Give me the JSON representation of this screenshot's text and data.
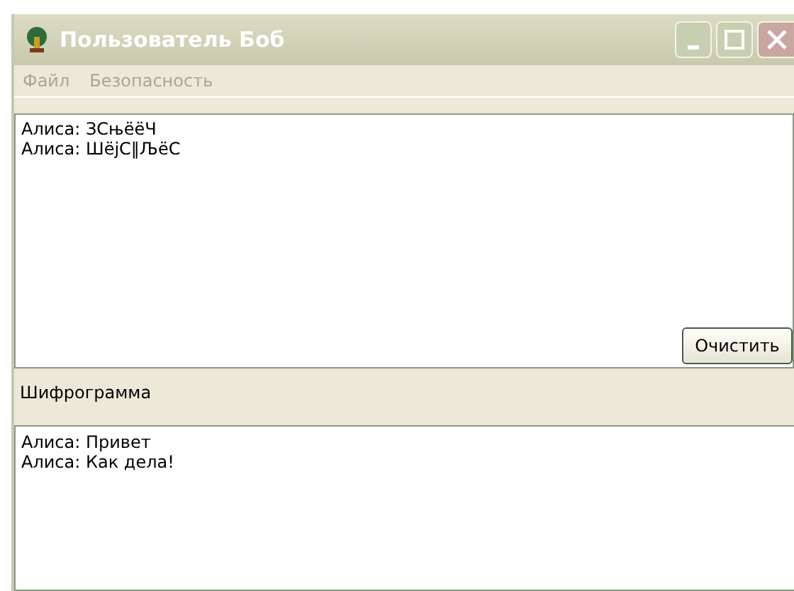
{
  "window": {
    "title": "Пользователь Боб",
    "active": false
  },
  "menu": [
    {
      "label": "Файл",
      "disabled": true
    },
    {
      "label": "Безопасность",
      "disabled": true
    }
  ],
  "received": {
    "lines": [
      "Алиса: ЗСњёёЧ",
      "Алиса: ШёјС‖ЉёС"
    ]
  },
  "clear_button": {
    "label": "Очистить"
  },
  "cipher_label": "Шифрограмма",
  "cipher": {
    "lines": [
      "Алиса: Привет",
      "Алиса: Как дела!"
    ]
  }
}
